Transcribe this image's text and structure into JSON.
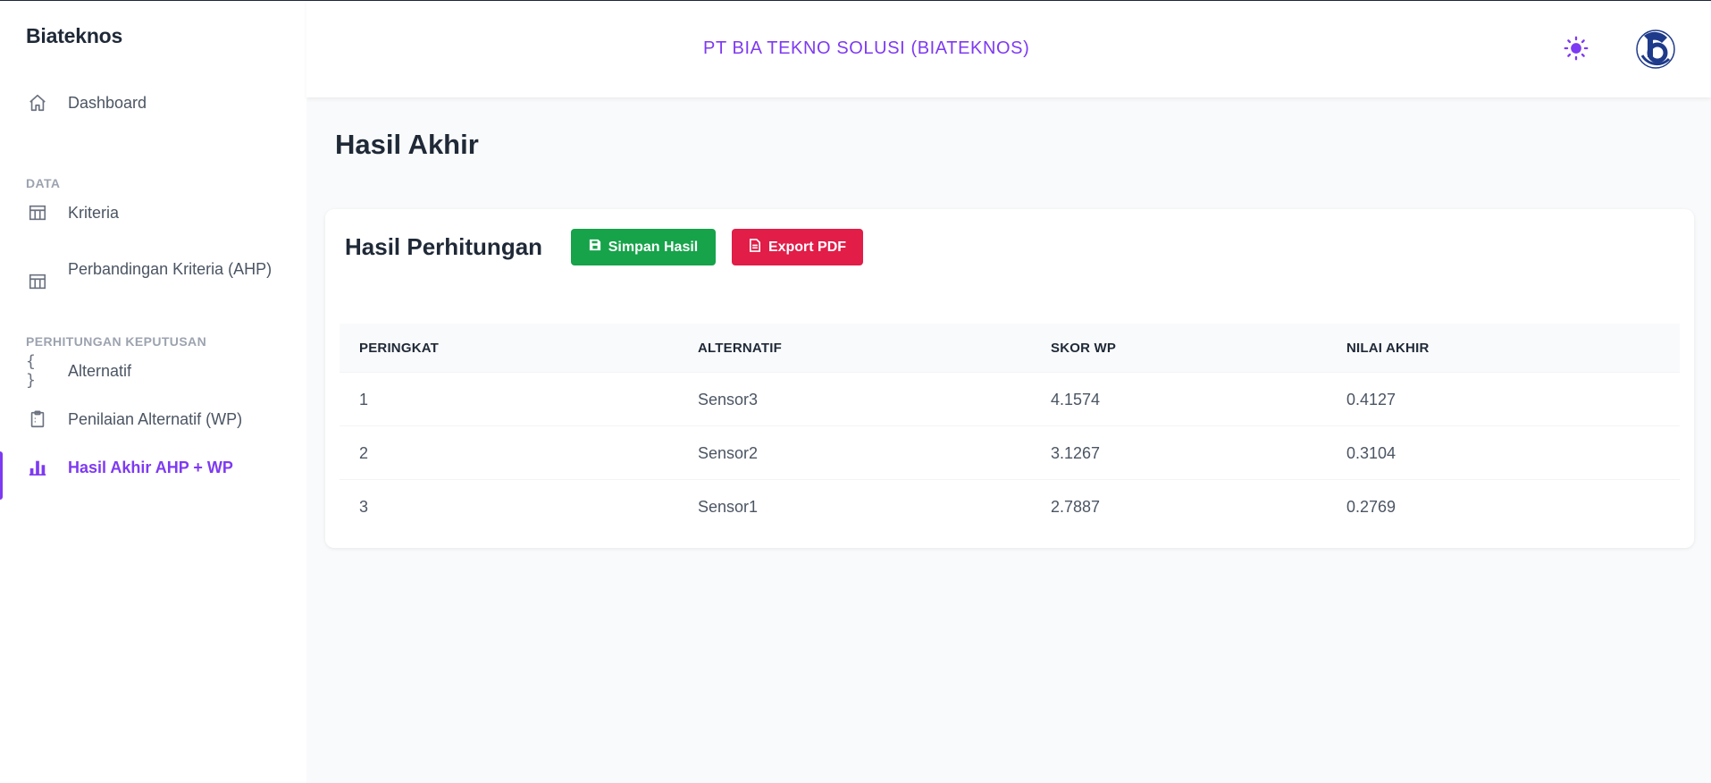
{
  "app": {
    "brand": "Biateknos"
  },
  "header": {
    "title": "PT BIA TEKNO SOLUSI (BIATEKNOS)",
    "theme_icon": "sun-icon",
    "accent": "#7e3af2"
  },
  "sidebar": {
    "dashboard": {
      "label": "Dashboard",
      "icon": "home-icon"
    },
    "section_data": "DATA",
    "kriteria": {
      "label": "Kriteria",
      "icon": "table-icon"
    },
    "perbandingan": {
      "label": "Perbandingan Kriteria (AHP)",
      "icon": "table-icon"
    },
    "section_perhitungan": "PERHITUNGAN KEPUTUSAN",
    "alternatif": {
      "label": "Alternatif",
      "icon": "braces-icon"
    },
    "penilaian": {
      "label": "Penilaian Alternatif (WP)",
      "icon": "clipboard-icon"
    },
    "hasil": {
      "label": "Hasil Akhir AHP + WP",
      "icon": "bar-chart-icon",
      "active": true
    }
  },
  "main": {
    "page_title": "Hasil Akhir",
    "card": {
      "title": "Hasil Perhitungan",
      "save_label": "Simpan Hasil",
      "save_color": "#16a34a",
      "export_label": "Export PDF",
      "export_color": "#e11d48"
    },
    "table": {
      "headers": [
        "PERINGKAT",
        "ALTERNATIF",
        "SKOR WP",
        "NILAI AKHIR"
      ],
      "rows": [
        [
          "1",
          "Sensor3",
          "4.1574",
          "0.4127"
        ],
        [
          "2",
          "Sensor2",
          "3.1267",
          "0.3104"
        ],
        [
          "3",
          "Sensor1",
          "2.7887",
          "0.2769"
        ]
      ]
    }
  }
}
